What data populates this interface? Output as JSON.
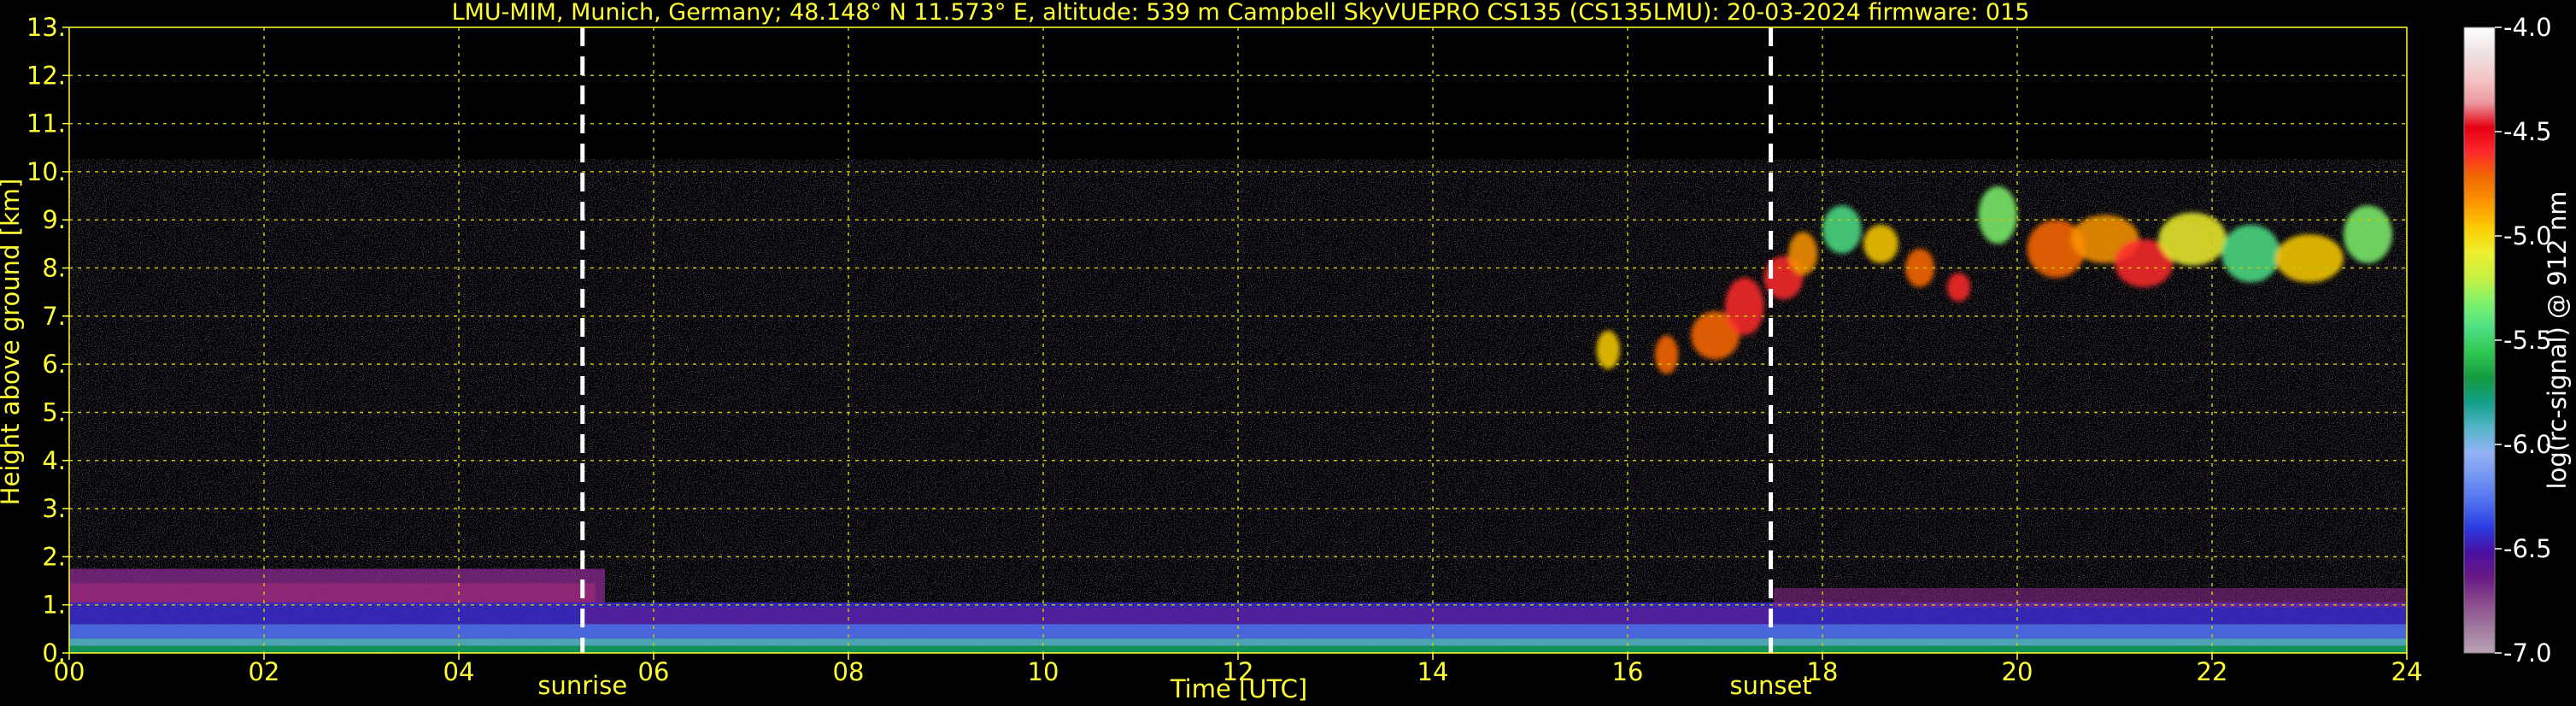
{
  "chart_data": {
    "type": "heatmap",
    "title": "LMU-MIM, Munich, Germany; 48.148° N 11.573° E, altitude: 539 m    Campbell SkyVUEPRO CS135 (CS135LMU): 20-03-2024    firmware: 015",
    "xlabel": "Time [UTC]",
    "ylabel": "Height above ground [km]",
    "xlim": [
      0,
      24
    ],
    "ylim": [
      0,
      13
    ],
    "xticks": [
      "00",
      "02",
      "04",
      "06",
      "08",
      "10",
      "12",
      "14",
      "16",
      "18",
      "20",
      "22",
      "24"
    ],
    "yticks": [
      "0.",
      "1.",
      "2.",
      "3.",
      "4.",
      "5.",
      "6.",
      "7.",
      "8.",
      "9.",
      "10.",
      "11.",
      "12.",
      "13."
    ],
    "grid": true,
    "data_top_km": 10.25,
    "sunrise": {
      "label": "sunrise",
      "time_utc": 5.27
    },
    "sunset": {
      "label": "sunset",
      "time_utc": 17.47
    },
    "colorbar": {
      "label": "log(rc-signal) @ 912 nm",
      "range": [
        -7.0,
        -4.0
      ],
      "ticks": [
        "-4.0",
        "-4.5",
        "-5.0",
        "-5.5",
        "-6.0",
        "-6.5",
        "-7.0"
      ],
      "colors": [
        "#b9a3b6",
        "#a07a9f",
        "#8a4c8e",
        "#6a1a84",
        "#4a0fa0",
        "#2a3ae0",
        "#4f6ff0",
        "#7294f2",
        "#93b2f5",
        "#54b4c8",
        "#12a08a",
        "#149a40",
        "#2ec750",
        "#4ee085",
        "#7ef26c",
        "#c8f040",
        "#eef030",
        "#fccc00",
        "#fc9400",
        "#f06a00",
        "#ff2a2a",
        "#e40012",
        "#ec9aa0",
        "#f4c6c8",
        "#eee2e2",
        "#ffffff"
      ]
    },
    "layers": [
      {
        "name": "boundary-layer aerosol",
        "time_range": [
          0,
          24
        ],
        "height_km": [
          0.1,
          1.8
        ]
      },
      {
        "name": "cirrus cloud",
        "time_range": [
          16.4,
          24
        ],
        "height_km": [
          6.0,
          10.25
        ]
      }
    ]
  }
}
